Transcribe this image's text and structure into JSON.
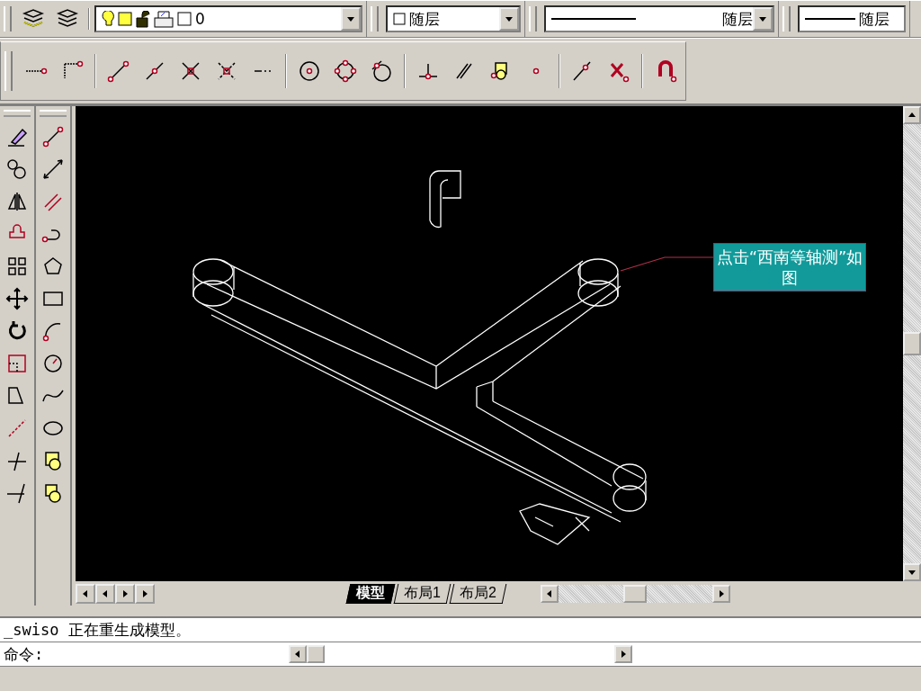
{
  "layer_toolbar": {
    "layer": {
      "value": "0"
    },
    "color": {
      "value": "随层"
    },
    "linetype": {
      "value": "随层"
    },
    "lineweight": {
      "value": "随层"
    }
  },
  "callout": {
    "text": "点击“西南等轴测”如图"
  },
  "layout_tabs": [
    {
      "label": "模型",
      "selected": true
    },
    {
      "label": "布局1",
      "selected": false
    },
    {
      "label": "布局2",
      "selected": false
    }
  ],
  "command_history": [
    "_swiso 正在重生成模型。"
  ],
  "command_prompt": "命令:"
}
